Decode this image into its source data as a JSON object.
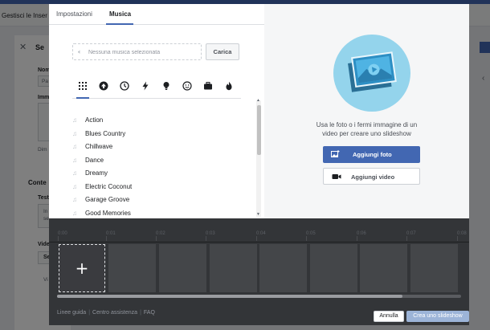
{
  "background": {
    "header_title": "Gestisci le Inser",
    "panel_title": "Se",
    "labels": [
      "Nom",
      "Pa",
      "Imm",
      "Dim",
      "Conte",
      "Test",
      "In",
      "se",
      "Vide",
      "Se",
      "Vi"
    ]
  },
  "tabs": [
    {
      "label": "Impostazioni",
      "active": false
    },
    {
      "label": "Musica",
      "active": true
    }
  ],
  "music": {
    "placeholder": "Nessuna musica selezionata",
    "upload_label": "Carica"
  },
  "categories": [
    {
      "icon": "grid-icon",
      "active": true
    },
    {
      "icon": "arrow-up-icon",
      "active": false
    },
    {
      "icon": "clock-icon",
      "active": false
    },
    {
      "icon": "lightning-icon",
      "active": false
    },
    {
      "icon": "lightbulb-icon",
      "active": false
    },
    {
      "icon": "smiley-icon",
      "active": false
    },
    {
      "icon": "briefcase-icon",
      "active": false
    },
    {
      "icon": "flame-icon",
      "active": false
    }
  ],
  "tracks": [
    "Action",
    "Blues Country",
    "Chillwave",
    "Dance",
    "Dreamy",
    "Electric Coconut",
    "Garage Groove",
    "Good Memories"
  ],
  "right": {
    "description": "Usa le foto o i fermi immagine di un video per creare uno slideshow",
    "add_photo": "Aggiungi foto",
    "add_video": "Aggiungi video"
  },
  "timeline": {
    "ticks": [
      "0:00",
      "0:01",
      "0:02",
      "0:03",
      "0:04",
      "0:05",
      "0:06",
      "0:07",
      "0:08"
    ],
    "add_symbol": "+",
    "slot_count": 7
  },
  "footer": {
    "links": [
      "Linee guida",
      "Centro assistenza",
      "FAQ"
    ],
    "cancel": "Annulla",
    "create": "Crea uno slideshow"
  },
  "colors": {
    "accent": "#4267b2",
    "illustration_bg": "#94d4ec",
    "timeline_bg": "#333538",
    "create_disabled": "#9cb4d8"
  }
}
